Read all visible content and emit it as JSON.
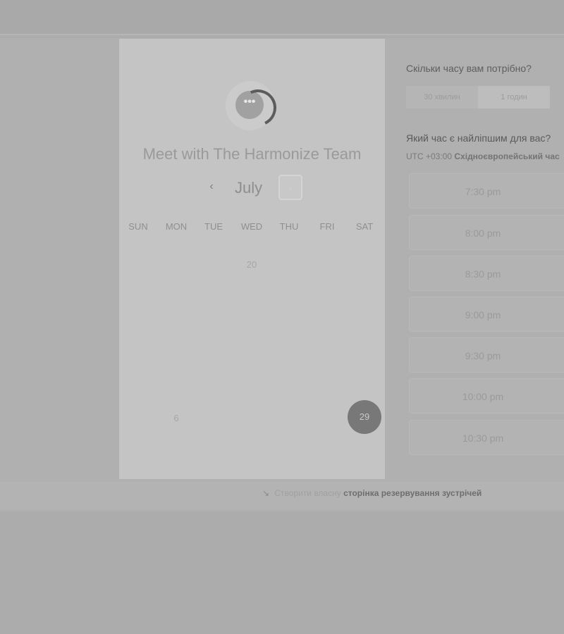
{
  "calendar": {
    "title": "Meet with The Harmonize Team",
    "month": "July",
    "prev_glyph": "‹",
    "next_glyph": "›",
    "weekdays": [
      "SUN",
      "MON",
      "TUE",
      "WED",
      "THU",
      "FRI",
      "SAT"
    ],
    "visible_days": [
      "20",
      "6"
    ],
    "selected_day": "29"
  },
  "duration": {
    "heading": "Скільки часу вам потрібно?",
    "options": [
      "30 хвилин",
      "1 годин"
    ],
    "selected": "30 хвилин"
  },
  "times": {
    "heading": "Який час є найліпшим для вас?",
    "timezone_offset": "UTC +03:00",
    "timezone_name": "Східноєвропейський час",
    "slots": [
      "7:30 pm",
      "8:00 pm",
      "8:30 pm",
      "9:00 pm",
      "9:30 pm",
      "10:00 pm",
      "10:30 pm"
    ]
  },
  "footer": {
    "prefix": "Створити власну",
    "link": "сторінка резервування зустрічей"
  },
  "colors": {
    "selected_day_bg": "#787878",
    "panel_bg": "#c4c4c4"
  },
  "icons": {
    "logo": "chat-bubble-logo-icon",
    "footer": "calendar-cursor-icon"
  }
}
